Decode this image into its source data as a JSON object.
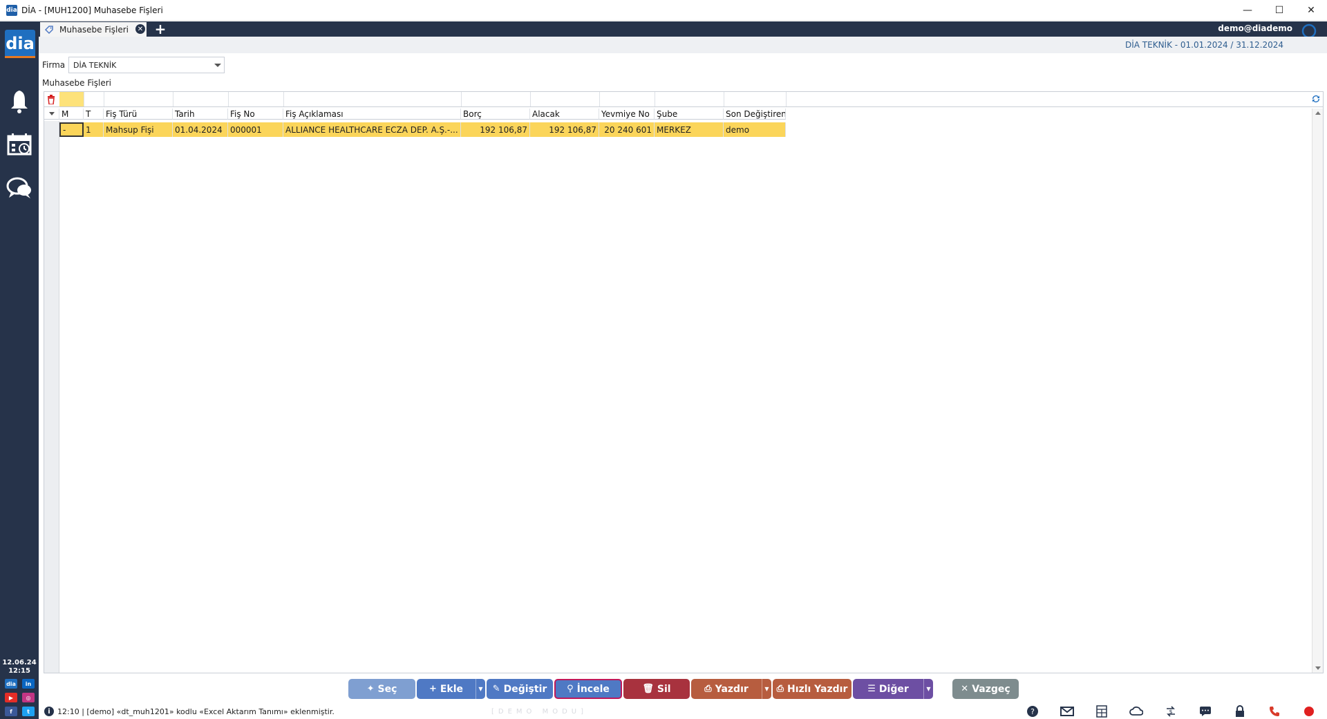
{
  "window": {
    "title": "DİA - [MUH1200] Muhasebe Fişleri",
    "app_icon": "dia",
    "controls": [
      "minimize-icon",
      "maximize-icon",
      "close-icon"
    ]
  },
  "sidebar": {
    "logo": "dia",
    "date": "12.06.24",
    "time": "12:15",
    "social": [
      "dia",
      "in",
      "▶",
      "◎",
      "f",
      "t"
    ]
  },
  "tabs": [
    {
      "label": "Muhasebe Fişleri",
      "active": true
    }
  ],
  "header": {
    "user": "demo@diademo",
    "period": "DİA TEKNİK -  01.01.2024 / 31.12.2024"
  },
  "firma": {
    "label": "Firma",
    "value": "DİA TEKNİK"
  },
  "grid": {
    "title": "Muhasebe Fişleri",
    "columns": [
      "M",
      "T",
      "Fiş Türü",
      "Tarih",
      "Fiş No",
      "Fiş Açıklaması",
      "Borç",
      "Alacak",
      "Yevmiye No",
      "Şube",
      "Son Değiştiren"
    ],
    "rows": [
      [
        "-",
        "1",
        "Mahsup Fişi",
        "01.04.2024",
        "000001",
        "ALLIANCE HEALTHCARE ECZA DEP. A.Ş.-...",
        "192 106,87",
        "192 106,87",
        "20 240 601",
        "MERKEZ",
        "demo"
      ]
    ]
  },
  "buttons": {
    "sec": "Seç",
    "ekle": "Ekle",
    "degistir": "Değiştir",
    "incele": "İncele",
    "sil": "Sil",
    "yazdir": "Yazdır",
    "hizli_yazdir": "Hızlı Yazdır",
    "diger": "Diğer",
    "vazgec": "Vazgeç"
  },
  "colors": {
    "sidebar": "#26334a",
    "highlight_row": "#fbd55a",
    "btn_sec": "#7f9fd1",
    "btn_ekle": "#4f79c4",
    "btn_degistir": "#4f79c4",
    "btn_incele": "#4f79c4",
    "btn_incele_border": "#c0185a",
    "btn_sil": "#a8323e",
    "btn_yazdir": "#b75d3f",
    "btn_hizli": "#b75d3f",
    "btn_diger": "#6d4fa3",
    "btn_vazgec": "#7e8c8e"
  },
  "status": {
    "message": "12:10 | [demo] «dt_muh1201» kodlu «Excel Aktarım Tanımı» eklenmiştir.",
    "mode": "[DEMO MODU]"
  }
}
